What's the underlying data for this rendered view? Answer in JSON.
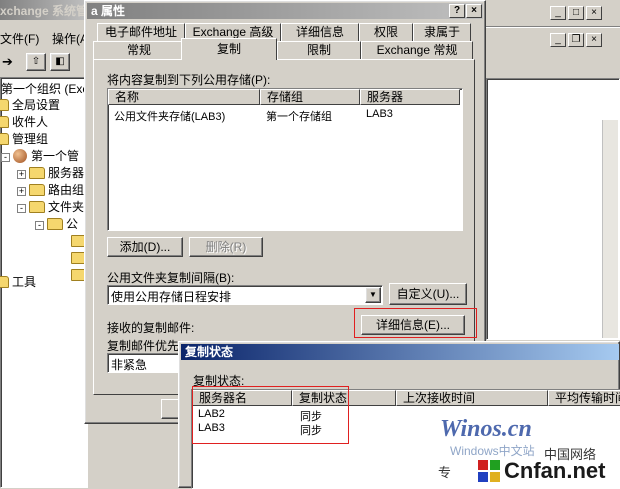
{
  "bg_window": {
    "title": "xchange 系统管",
    "menu": [
      "文件(F)",
      "操作(A)"
    ],
    "tree": [
      {
        "label": "第一个组织 (Exc",
        "depth": 0
      },
      {
        "label": "全局设置",
        "depth": 1
      },
      {
        "label": "收件人",
        "depth": 1
      },
      {
        "label": "管理组",
        "depth": 1
      },
      {
        "label": "第一个管",
        "depth": 2
      },
      {
        "label": "服务器",
        "depth": 3
      },
      {
        "label": "路由组",
        "depth": 3
      },
      {
        "label": "文件夹",
        "depth": 3
      },
      {
        "label": "公",
        "depth": 4
      },
      {
        "label": "工具",
        "depth": 1
      }
    ],
    "expanders": [
      "+",
      "+",
      "+",
      "-",
      "-"
    ]
  },
  "props_dialog": {
    "title": "a 属性",
    "help_btn": "?",
    "close_btn": "×",
    "tabs_row1": [
      "电子邮件地址",
      "Exchange 高级",
      "详细信息",
      "权限",
      "隶属于"
    ],
    "tabs_row2": [
      "常规",
      "复制",
      "限制",
      "Exchange 常规"
    ],
    "replicate_label": "将内容复制到下列公用存储(P):",
    "list_headers": [
      "名称",
      "存储组",
      "服务器"
    ],
    "list_rows": [
      [
        "公用文件夹存储(LAB3)",
        "第一个存储组",
        "LAB3"
      ]
    ],
    "add_btn": "添加(D)...",
    "remove_btn": "删除(R)",
    "interval_label": "公用文件夹复制间隔(B):",
    "interval_value": "使用公用存储日程安排",
    "customize_btn": "自定义(U)...",
    "received_label": "接收的复制邮件:",
    "details_btn": "详细信息(E)...",
    "priority_label": "复制邮件优先",
    "priority_value": "非紧急"
  },
  "status_dialog": {
    "title": "复制状态",
    "status_label": "复制状态:",
    "headers": [
      "服务器名",
      "复制状态",
      "上次接收时间",
      "平均传输时间"
    ],
    "rows": [
      [
        "LAB2",
        "同步"
      ],
      [
        "LAB3",
        "同步"
      ]
    ]
  },
  "watermark": {
    "line1": "Winos.cn",
    "line2": "Windows中文站",
    "line3": "中国网络",
    "line4": "专",
    "line5": "Cnfan.net"
  },
  "colors": {
    "face": "#d4d0c8",
    "title_active": "#0a246a",
    "title_active_end": "#a6caf0",
    "highlight": "#e02020"
  }
}
